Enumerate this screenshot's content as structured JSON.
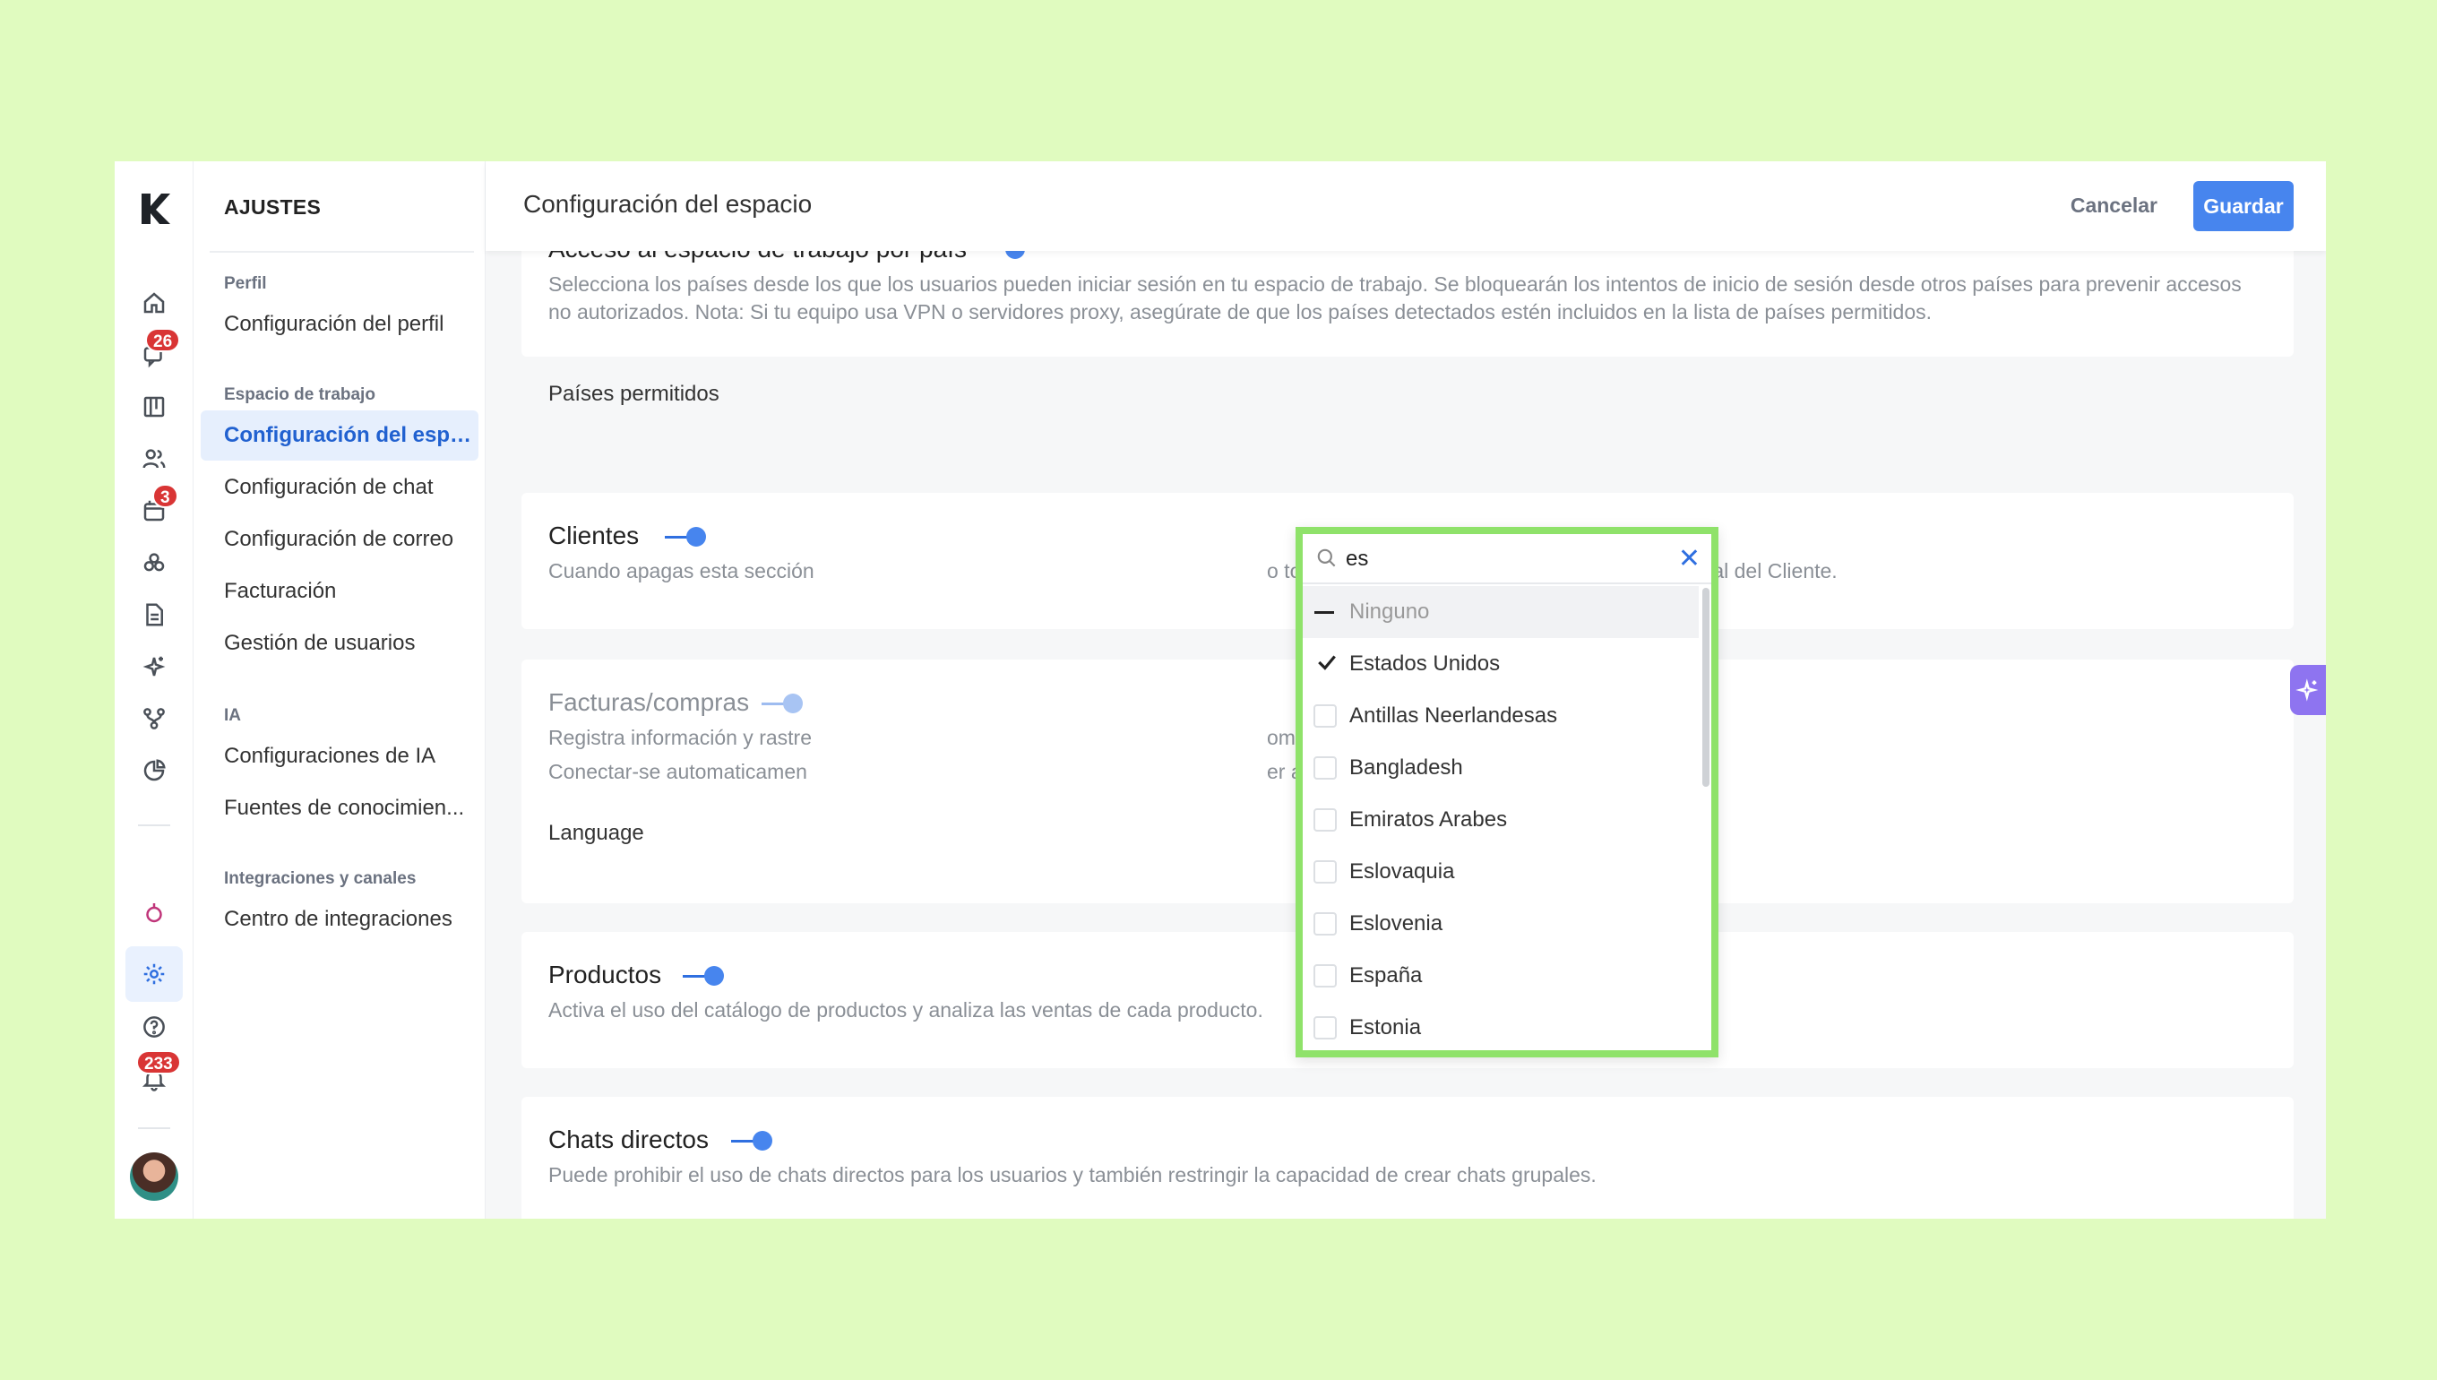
{
  "sidebar": {
    "heading": "AJUSTES",
    "sections": [
      {
        "title": "Perfil",
        "items": [
          "Configuración del perfil"
        ]
      },
      {
        "title": "Espacio de trabajo",
        "items": [
          "Configuración del espa...",
          "Configuración de chat",
          "Configuración de correo",
          "Facturación",
          "Gestión de usuarios"
        ]
      },
      {
        "title": "IA",
        "items": [
          "Configuraciones de IA",
          "Fuentes de conocimien..."
        ]
      },
      {
        "title": "Integraciones y canales",
        "items": [
          "Centro de integraciones"
        ]
      }
    ]
  },
  "rail": {
    "badges": {
      "chats": "26",
      "calendar": "3",
      "notifications": "233"
    },
    "icons": [
      "home-icon",
      "chat-icon",
      "board-icon",
      "contacts-icon",
      "calendar-icon",
      "groups-icon",
      "document-icon",
      "sparkles-icon",
      "flow-icon",
      "reports-icon",
      "settings-icon",
      "help-icon",
      "bell-icon"
    ]
  },
  "header": {
    "title": "Configuración del espacio",
    "cancel_label": "Cancelar",
    "save_label": "Guardar"
  },
  "cards": {
    "country_access": {
      "title": "Acceso al espacio de trabajo por país",
      "enabled": true,
      "description": "Selecciona los países desde los que los usuarios pueden iniciar sesión en tu espacio de trabajo. Se bloquearán los intentos de inicio de sesión desde otros países para prevenir accesos no autorizados. Nota: Si tu equipo usa VPN o servidores proxy, asegúrate de que los países detectados estén incluidos en la lista de países permitidos.",
      "field_label": "Países permitidos"
    },
    "clients": {
      "title": "Clientes",
      "enabled": true,
      "description_left": "Cuando apagas esta sección",
      "description_right": "o todos los campos de entrada y el Pipeline Digital del Cliente."
    },
    "invoices": {
      "title": "Facturas/compras",
      "enabled": false,
      "line1_left": "Registra información y rastre",
      "line1_right": "ompra.",
      "line2_left": "Conectar-se automaticamen",
      "line2_right": "er ativado.",
      "field_label": "Language"
    },
    "products": {
      "title": "Productos",
      "enabled": true,
      "description": "Activa el uso del catálogo de productos y analiza las ventas de cada producto."
    },
    "direct_chats": {
      "title": "Chats directos",
      "enabled": true,
      "description": "Puede prohibir el uso de chats directos para los usuarios y también restringir la capacidad de crear chats grupales."
    }
  },
  "country_dropdown": {
    "search_value": "es",
    "none_label": "Ninguno",
    "options": [
      {
        "label": "Estados Unidos",
        "checked": true
      },
      {
        "label": "Antillas Neerlandesas",
        "checked": false
      },
      {
        "label": "Bangladesh",
        "checked": false
      },
      {
        "label": "Emiratos Arabes",
        "checked": false
      },
      {
        "label": "Eslovaquia",
        "checked": false
      },
      {
        "label": "Eslovenia",
        "checked": false
      },
      {
        "label": "España",
        "checked": false
      },
      {
        "label": "Estonia",
        "checked": false
      }
    ]
  },
  "colors": {
    "accent": "#4785ee",
    "highlight_border": "#8fe26a",
    "badge": "#d93535",
    "background": "#e0fbbf"
  }
}
